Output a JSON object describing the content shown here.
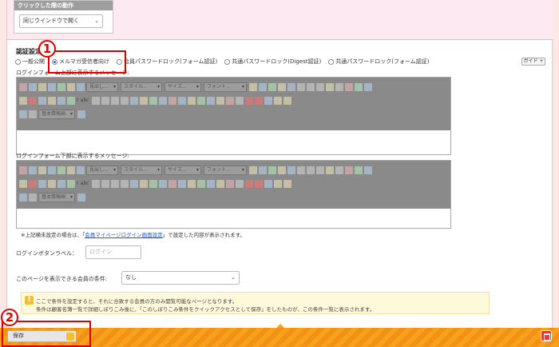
{
  "click_action": {
    "heading": "クリックした際の動作",
    "selected": "同じウインドウで開く"
  },
  "auth": {
    "title": "認証設定",
    "radios": [
      {
        "label": "一般公開",
        "checked": false
      },
      {
        "label": "メルマガ受信者向け",
        "checked": true
      },
      {
        "label": "会員パスワードロック(フォーム認証)",
        "checked": false
      },
      {
        "label": "共通パスワードロック(Digest認証)",
        "checked": false
      },
      {
        "label": "共通パスワードロック(フォーム認証)",
        "checked": false
      }
    ],
    "guide_label": "ガイド +"
  },
  "editor_top": {
    "label": "ログインフォーム上部に表示するメッセージ:"
  },
  "editor_bottom": {
    "label": "ログインフォーム下部に表示するメッセージ:"
  },
  "toolbar": {
    "format_combo": "見出し...",
    "style_combo": "スタイル...",
    "size_combo": "サイズ...",
    "font_combo": "フォント...",
    "info_combo": "基本情報画"
  },
  "note": {
    "prefix": "※上記横未設定の場合は、「",
    "link": "会員マイページログイン画面設定",
    "suffix": "」で設定した内容が表示されます。"
  },
  "login_button": {
    "label": "ログインボタンラベル：",
    "placeholder": "ログイン"
  },
  "member_condition": {
    "label": "このページを表示できる会員の条件:",
    "selected": "なし"
  },
  "info": {
    "line1": "ここで条件を設定すると、それに合致する会員の方のみ閲覧可能なページとなります。",
    "line2": "条件は顧客名簿一覧で詳細しぼりこみ後に、「このしぼりこみ条件をクイックアクセスとして保存」をしたものが、この条件一覧に表示されます。"
  },
  "callouts": {
    "one": "1",
    "two": "2"
  },
  "footer": {
    "save_label": "保存"
  }
}
